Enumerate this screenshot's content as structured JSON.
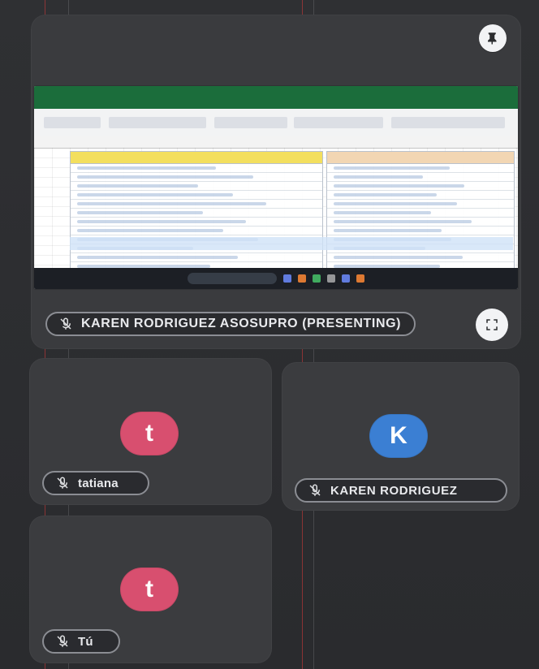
{
  "main_tile": {
    "participant_label": "KAREN RODRIGUEZ ASOSUPRO (presenting)"
  },
  "participants": [
    {
      "name": "tatiana",
      "initial": "t"
    },
    {
      "name": "KAREN RODRIGUEZ",
      "initial": "K"
    },
    {
      "name": "Tú",
      "initial": "t"
    }
  ],
  "icons": {
    "pin": "pin-icon",
    "fullscreen": "fullscreen-icon",
    "mic_off": "mic-off-icon"
  },
  "colors": {
    "background": "#2b2c2f",
    "tile": "#3b3c3f",
    "avatar_red": "#d84f6f",
    "avatar_blue": "#3b7fd3"
  }
}
